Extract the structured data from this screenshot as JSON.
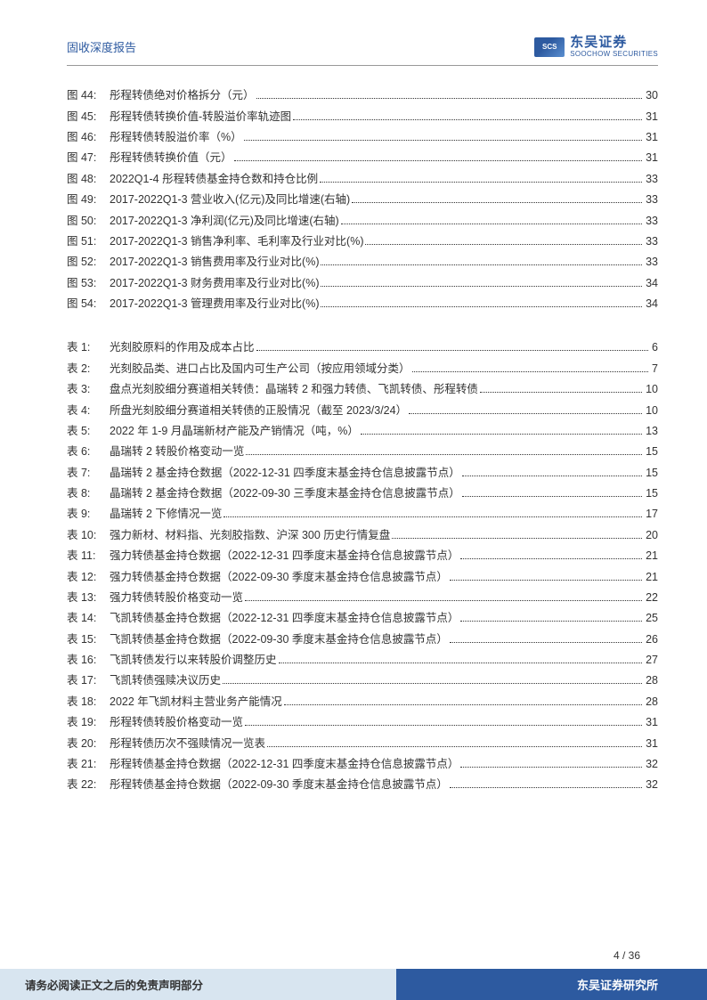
{
  "header": {
    "title": "固收深度报告",
    "logo_cn": "东吴证券",
    "logo_en": "SOOCHOW SECURITIES",
    "logo_mark": "SCS"
  },
  "figures": [
    {
      "label": "图 44:",
      "title": "彤程转债绝对价格拆分（元）",
      "page": "30"
    },
    {
      "label": "图 45:",
      "title": "彤程转债转换价值-转股溢价率轨迹图",
      "page": "31"
    },
    {
      "label": "图 46:",
      "title": "彤程转债转股溢价率（%）",
      "page": "31"
    },
    {
      "label": "图 47:",
      "title": "彤程转债转换价值（元）",
      "page": "31"
    },
    {
      "label": "图 48:",
      "title": "2022Q1-4 彤程转债基金持仓数和持仓比例",
      "page": "33"
    },
    {
      "label": "图 49:",
      "title": "2017-2022Q1-3 营业收入(亿元)及同比增速(右轴)",
      "page": "33"
    },
    {
      "label": "图 50:",
      "title": "2017-2022Q1-3 净利润(亿元)及同比增速(右轴)",
      "page": "33"
    },
    {
      "label": "图 51:",
      "title": "2017-2022Q1-3 销售净利率、毛利率及行业对比(%)",
      "page": "33"
    },
    {
      "label": "图 52:",
      "title": "2017-2022Q1-3 销售费用率及行业对比(%)",
      "page": "33"
    },
    {
      "label": "图 53:",
      "title": "2017-2022Q1-3 财务费用率及行业对比(%)",
      "page": "34"
    },
    {
      "label": "图 54:",
      "title": "2017-2022Q1-3 管理费用率及行业对比(%)",
      "page": "34"
    }
  ],
  "tables": [
    {
      "label": "表 1:",
      "title": "光刻胶原料的作用及成本占比",
      "page": "6"
    },
    {
      "label": "表 2:",
      "title": "光刻胶品类、进口占比及国内可生产公司（按应用领域分类）",
      "page": "7"
    },
    {
      "label": "表 3:",
      "title": "盘点光刻胶细分赛道相关转债：晶瑞转 2 和强力转债、飞凯转债、彤程转债",
      "page": "10"
    },
    {
      "label": "表 4:",
      "title": "所盘光刻胶细分赛道相关转债的正股情况（截至 2023/3/24）",
      "page": "10"
    },
    {
      "label": "表 5:",
      "title": "2022 年 1-9 月晶瑞新材产能及产销情况（吨，%）",
      "page": "13"
    },
    {
      "label": "表 6:",
      "title": "晶瑞转 2 转股价格变动一览",
      "page": "15"
    },
    {
      "label": "表 7:",
      "title": "晶瑞转 2 基金持仓数据（2022-12-31 四季度末基金持仓信息披露节点）",
      "page": "15"
    },
    {
      "label": "表 8:",
      "title": "晶瑞转 2 基金持仓数据（2022-09-30 三季度末基金持仓信息披露节点）",
      "page": "15"
    },
    {
      "label": "表 9:",
      "title": "晶瑞转 2 下修情况一览",
      "page": "17"
    },
    {
      "label": "表 10:",
      "title": "强力新材、材料指、光刻胶指数、沪深 300 历史行情复盘",
      "page": "20"
    },
    {
      "label": "表 11:",
      "title": "强力转债基金持仓数据（2022-12-31 四季度末基金持仓信息披露节点）",
      "page": "21"
    },
    {
      "label": "表 12:",
      "title": "强力转债基金持仓数据（2022-09-30 季度末基金持仓信息披露节点）",
      "page": "21"
    },
    {
      "label": "表 13:",
      "title": "强力转债转股价格变动一览",
      "page": "22"
    },
    {
      "label": "表 14:",
      "title": "飞凯转债基金持仓数据（2022-12-31 四季度末基金持仓信息披露节点）",
      "page": "25"
    },
    {
      "label": "表 15:",
      "title": "飞凯转债基金持仓数据（2022-09-30 季度末基金持仓信息披露节点）",
      "page": "26"
    },
    {
      "label": "表 16:",
      "title": "飞凯转债发行以来转股价调整历史",
      "page": "27"
    },
    {
      "label": "表 17:",
      "title": "飞凯转债强赎决议历史",
      "page": "28"
    },
    {
      "label": "表 18:",
      "title": "2022 年飞凯材料主营业务产能情况",
      "page": "28"
    },
    {
      "label": "表 19:",
      "title": "彤程转债转股价格变动一览",
      "page": "31"
    },
    {
      "label": "表 20:",
      "title": "彤程转债历次不强赎情况一览表",
      "page": "31"
    },
    {
      "label": "表 21:",
      "title": "彤程转债基金持仓数据（2022-12-31 四季度末基金持仓信息披露节点）",
      "page": "32"
    },
    {
      "label": "表 22:",
      "title": "彤程转债基金持仓数据（2022-09-30 季度末基金持仓信息披露节点）",
      "page": "32"
    }
  ],
  "footer": {
    "page_num": "4 / 36",
    "disclaimer": "请务必阅读正文之后的免责声明部分",
    "org": "东吴证券研究所"
  }
}
